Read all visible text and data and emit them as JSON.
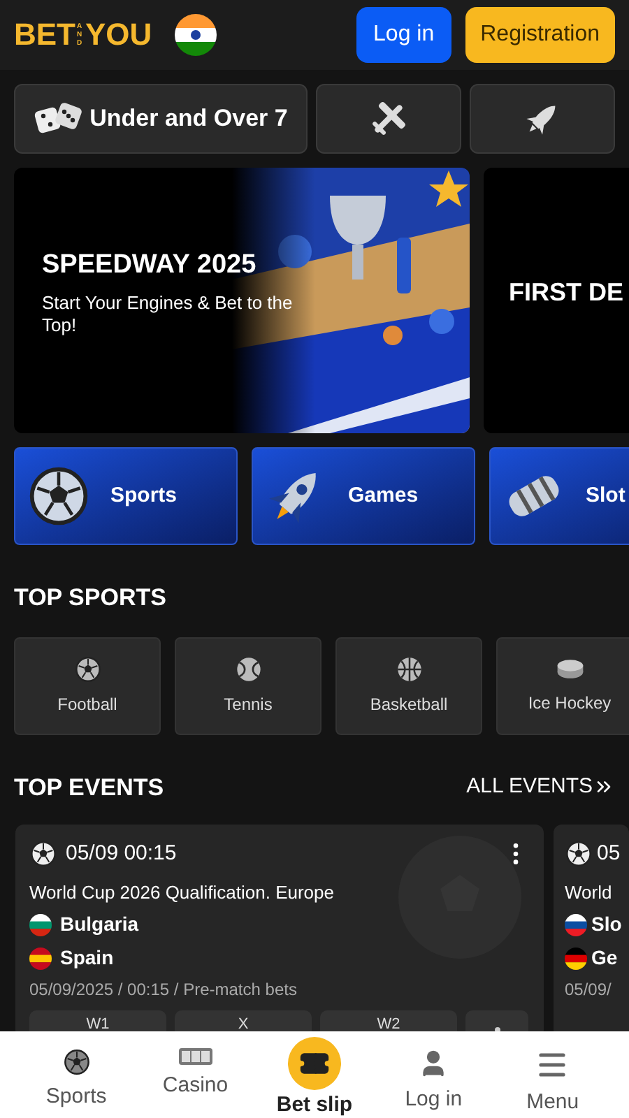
{
  "header": {
    "logo": [
      "BET",
      "AND",
      "YOU"
    ],
    "login": "Log in",
    "registration": "Registration"
  },
  "quick_game": {
    "label": "Under and Over 7"
  },
  "banners": [
    {
      "title": "SPEEDWAY 2025",
      "subtitle": "Start Your Engines & Bet to the Top!",
      "kind": "picture"
    },
    {
      "title": "FIRST DE"
    }
  ],
  "categories": [
    {
      "label": "Sports"
    },
    {
      "label": "Games"
    },
    {
      "label": "Slot"
    }
  ],
  "top_sports": {
    "title": "TOP SPORTS",
    "items": [
      {
        "label": "Football"
      },
      {
        "label": "Tennis"
      },
      {
        "label": "Basketball"
      },
      {
        "label": "Ice Hockey"
      }
    ]
  },
  "top_events": {
    "title": "TOP EVENTS",
    "all_link": "ALL EVENTS",
    "events": [
      {
        "time": "05/09 00:15",
        "league": "World Cup 2026 Qualification. Europe",
        "teams": [
          "Bulgaria",
          "Spain"
        ],
        "info": "05/09/2025 / 00:15 / Pre-match bets",
        "odds": [
          "W1",
          "X",
          "W2"
        ]
      },
      {
        "time": "05",
        "league": "World",
        "teams": [
          "Slo",
          "Ge"
        ],
        "info": "05/09/"
      }
    ]
  },
  "bottom_nav": [
    {
      "label": "Sports",
      "selected": false
    },
    {
      "label": "Casino",
      "selected": false
    },
    {
      "label": "Bet slip",
      "selected": true
    },
    {
      "label": "Log in",
      "selected": false
    },
    {
      "label": "Menu",
      "selected": false
    }
  ]
}
